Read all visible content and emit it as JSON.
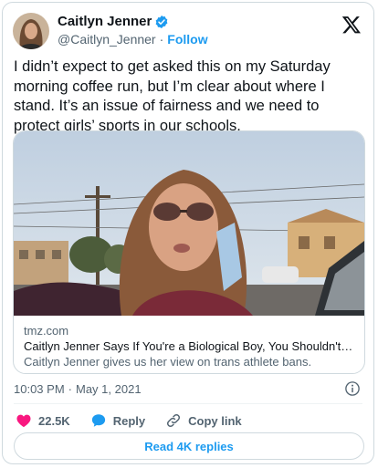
{
  "author": {
    "name": "Caitlyn Jenner",
    "handle": "@Caitlyn_Jenner",
    "separator": "·",
    "follow_label": "Follow",
    "verified_icon": "verified-badge-icon"
  },
  "tweet": {
    "text": "I didn’t expect to get asked this on my Saturday morning coffee run, but I’m clear about where I stand. It’s an issue of fairness and we need to protect girls’ sports in our schools."
  },
  "card": {
    "domain": "tmz.com",
    "title": "Caitlyn Jenner Says If You're a Biological Boy, You Shouldn't be in Girls' S...",
    "description": "Caitlyn Jenner gives us her view on trans athlete bans."
  },
  "meta": {
    "time": "10:03 PM",
    "separator": "·",
    "date": "May 1, 2021"
  },
  "actions": {
    "likes": "22.5K",
    "reply_label": "Reply",
    "copy_link_label": "Copy link"
  },
  "replies_button": "Read 4K replies",
  "colors": {
    "accent": "#1d9bf0",
    "like": "#f91880",
    "text": "#0f1419",
    "muted": "#536471"
  }
}
